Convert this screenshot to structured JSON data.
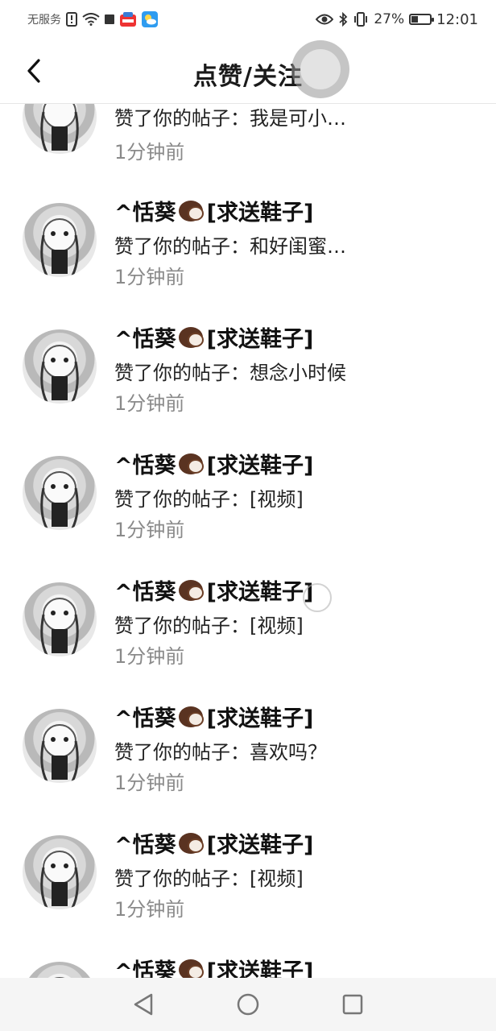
{
  "status_bar": {
    "carrier": "无服务",
    "battery": "27%",
    "time": "12:01"
  },
  "header": {
    "title": "点赞/关注"
  },
  "first_row": {
    "text": "赞了你的帖子：我是可小…",
    "time": "1分钟前"
  },
  "items": [
    {
      "user_name_prefix": "^恬葵",
      "user_name_suffix": "[求送鞋子]",
      "text": "赞了你的帖子：和好闺蜜…",
      "time": "1分钟前"
    },
    {
      "user_name_prefix": "^恬葵",
      "user_name_suffix": "[求送鞋子]",
      "text": "赞了你的帖子：想念小时候",
      "time": "1分钟前"
    },
    {
      "user_name_prefix": "^恬葵",
      "user_name_suffix": "[求送鞋子]",
      "text": "赞了你的帖子：[视频]",
      "time": "1分钟前"
    },
    {
      "user_name_prefix": "^恬葵",
      "user_name_suffix": "[求送鞋子]",
      "text": "赞了你的帖子：[视频]",
      "time": "1分钟前"
    },
    {
      "user_name_prefix": "^恬葵",
      "user_name_suffix": "[求送鞋子]",
      "text": "赞了你的帖子：喜欢吗？",
      "time": "1分钟前"
    },
    {
      "user_name_prefix": "^恬葵",
      "user_name_suffix": "[求送鞋子]",
      "text": "赞了你的帖子：[视频]",
      "time": "1分钟前"
    },
    {
      "user_name_prefix": "^恬葵",
      "user_name_suffix": "[求送鞋子]",
      "text": "",
      "time": ""
    }
  ],
  "icons": {
    "back": "back-arrow-icon",
    "emoji": "coconut-icon",
    "nav_back": "triangle-back-icon",
    "nav_home": "circle-home-icon",
    "nav_recent": "square-recent-icon"
  }
}
